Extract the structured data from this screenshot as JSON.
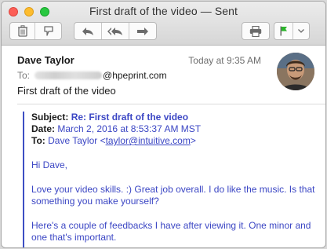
{
  "window": {
    "title": "First draft of the video — Sent"
  },
  "toolbar": {
    "buttons": [
      {
        "icon": "trash-icon"
      },
      {
        "icon": "junk-icon"
      },
      {
        "icon": "reply-icon"
      },
      {
        "icon": "reply-all-icon"
      },
      {
        "icon": "forward-icon"
      },
      {
        "icon": "print-icon"
      },
      {
        "icon": "flag-icon"
      }
    ]
  },
  "message": {
    "sender": "Dave Taylor",
    "timestamp": "Today at 9:35 AM",
    "to_label": "To:",
    "to_domain": "@hpeprint.com",
    "subject": "First draft of the video"
  },
  "quoted": {
    "subject_label": "Subject:",
    "subject_value": "Re: First draft of the video",
    "date_label": "Date:",
    "date_value": "March 2, 2016 at 8:53:37 AM MST",
    "to_label": "To:",
    "to_name": "Dave Taylor <",
    "to_email": "taylor@intuitive.com",
    "to_close": ">",
    "greeting": "Hi Dave,",
    "para1": "Love your video skills. :) Great job overall. I do like the music. Is that something you make yourself?",
    "para2": "Here's a couple of feedbacks I have after viewing it. One minor and one that's important."
  },
  "colors": {
    "accent": "#3b46c4",
    "flag": "#2cb52c"
  }
}
